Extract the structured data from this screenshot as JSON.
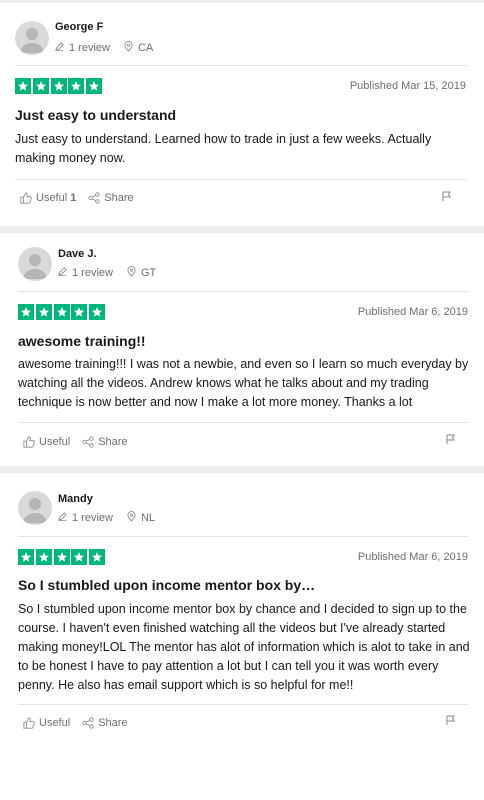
{
  "reviews": [
    {
      "name": "George F",
      "review_count": "1 review",
      "country": "CA",
      "rating": 5,
      "published": "Published Mar 15, 2019",
      "title": "Just easy to understand",
      "body": "Just easy to understand. Learned how to trade in just a few weeks. Actually making money now.",
      "useful_label": "Useful",
      "useful_count": "1",
      "share_label": "Share"
    },
    {
      "name": "Dave J.",
      "review_count": "1 review",
      "country": "GT",
      "rating": 5,
      "published": "Published Mar 6, 2019",
      "title": "awesome training!!",
      "body": "awesome training!!! I was not a newbie, and even so I learn so much everyday by watching all the videos. Andrew knows what he talks about and my trading technique is now better and now I make a lot more money. Thanks a lot",
      "useful_label": "Useful",
      "useful_count": "",
      "share_label": "Share"
    },
    {
      "name": "Mandy",
      "review_count": "1 review",
      "country": "NL",
      "rating": 5,
      "published": "Published Mar 6, 2019",
      "title": "So I stumbled upon income mentor box by…",
      "body": "So I stumbled upon income mentor box by chance and I decided to sign up to the course. I haven't even finished watching all the videos but I've already started making money!LOL The mentor has alot of information which is alot to take in and to be honest I have to pay attention a lot but I can tell you it was worth every penny. He also has email support which is so helpful for me!!",
      "useful_label": "Useful",
      "useful_count": "",
      "share_label": "Share"
    }
  ],
  "colors": {
    "star_green": "#00b67a",
    "separator": "#eceef0",
    "muted_text": "#6f6f6f"
  }
}
